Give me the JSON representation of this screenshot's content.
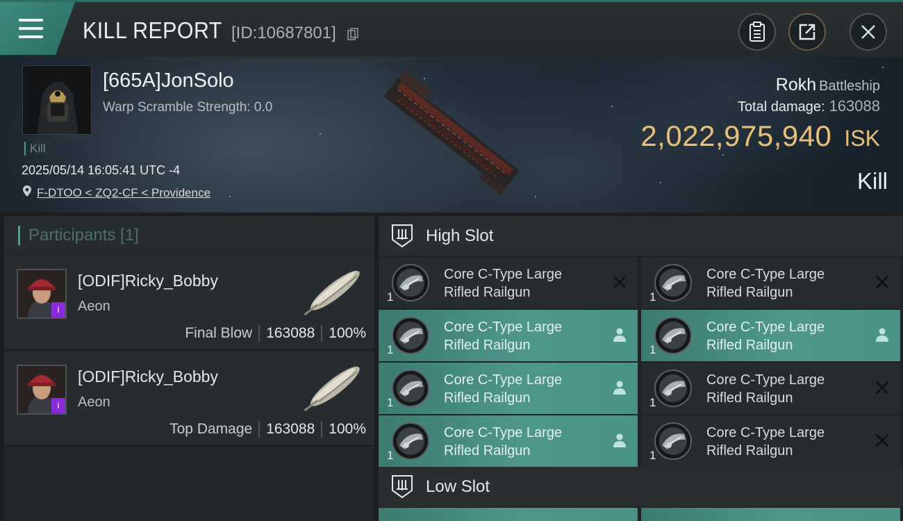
{
  "header": {
    "title": "KILL REPORT",
    "report_id": "[ID:10687801]",
    "menu_icon": "hamburger-menu-icon",
    "buttons": [
      "clipboard-icon",
      "share-icon",
      "close-icon"
    ]
  },
  "victim": {
    "name": "[665A]JonSolo",
    "warp_scramble": "Warp Scramble Strength: 0.0",
    "tag": "Kill",
    "timestamp": "2025/05/14 16:05:41 UTC -4",
    "location": "F-DTOO < ZQ2-CF < Providence",
    "ship_name": "Rokh",
    "ship_class": "Battleship",
    "total_damage_label": "Total damage:",
    "total_damage": "163088",
    "isk_value": "2,022,975,940",
    "isk_unit": "ISK",
    "result": "Kill"
  },
  "participants": {
    "title": "Participants [1]",
    "items": [
      {
        "name": "[ODIF]Ricky_Bobby",
        "ship": "Aeon",
        "role": "Final Blow",
        "damage": "163088",
        "percent": "100%",
        "badge": "i"
      },
      {
        "name": "[ODIF]Ricky_Bobby",
        "ship": "Aeon",
        "role": "Top Damage",
        "damage": "163088",
        "percent": "100%",
        "badge": "i"
      }
    ]
  },
  "slots": {
    "high_title": "High Slot",
    "low_title": "Low Slot",
    "high_modules": [
      {
        "line1": "Core C-Type Large",
        "line2": "Rifled Railgun",
        "qty": "1",
        "state": "destroyed"
      },
      {
        "line1": "Core C-Type Large",
        "line2": "Rifled Railgun",
        "qty": "1",
        "state": "destroyed"
      },
      {
        "line1": "Core C-Type Large",
        "line2": "Rifled Railgun",
        "qty": "1",
        "state": "fitted"
      },
      {
        "line1": "Core C-Type Large",
        "line2": "Rifled Railgun",
        "qty": "1",
        "state": "fitted"
      },
      {
        "line1": "Core C-Type Large",
        "line2": "Rifled Railgun",
        "qty": "1",
        "state": "fitted"
      },
      {
        "line1": "Core C-Type Large",
        "line2": "Rifled Railgun",
        "qty": "1",
        "state": "destroyed"
      },
      {
        "line1": "Core C-Type Large",
        "line2": "Rifled Railgun",
        "qty": "1",
        "state": "fitted"
      },
      {
        "line1": "Core C-Type Large",
        "line2": "Rifled Railgun",
        "qty": "1",
        "state": "destroyed"
      }
    ]
  },
  "colors": {
    "accent_teal": "#4f968c",
    "isk_gold": "#e8c07a",
    "corp_badge_purple": "#8a2bd8"
  }
}
